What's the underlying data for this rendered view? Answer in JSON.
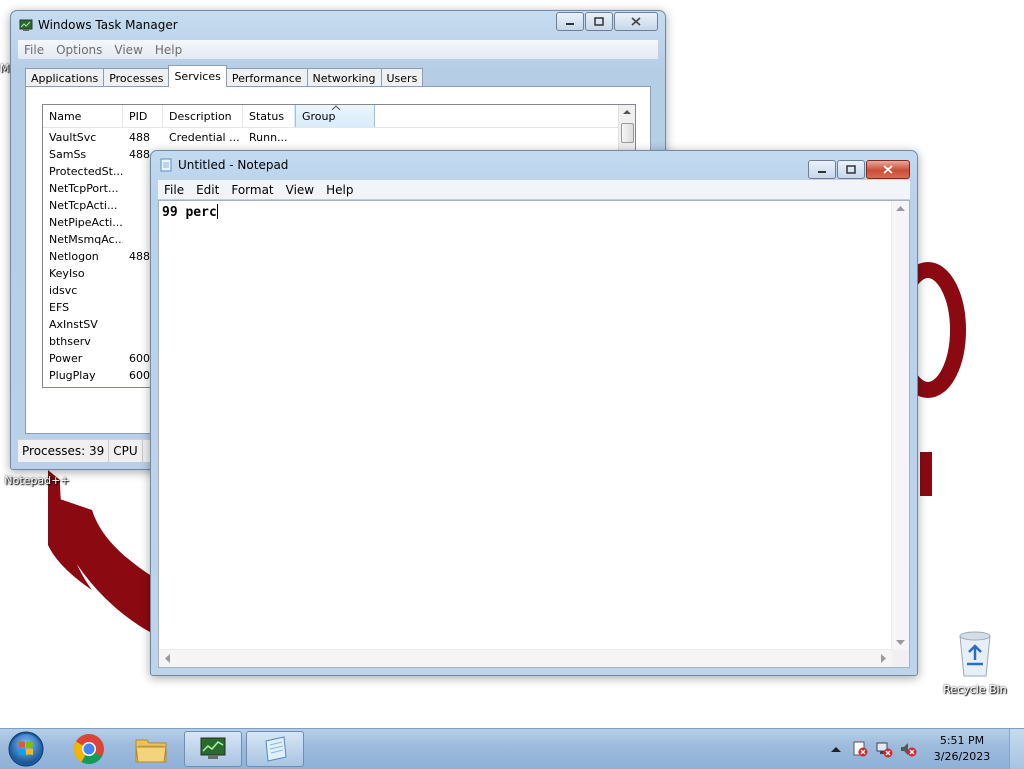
{
  "desktop": {
    "left_icon_partial": "M",
    "notepadpp_label": "Notepad++",
    "recycle_bin_label": "Recycle Bin",
    "wallpaper_color": "#8b0a12"
  },
  "task_manager": {
    "title": "Windows Task Manager",
    "menu": [
      "File",
      "Options",
      "View",
      "Help"
    ],
    "tabs": [
      "Applications",
      "Processes",
      "Services",
      "Performance",
      "Networking",
      "Users"
    ],
    "active_tab": "Services",
    "columns": [
      "Name",
      "PID",
      "Description",
      "Status",
      "Group"
    ],
    "rows": [
      {
        "name": "VaultSvc",
        "pid": "488",
        "description": "Credential ...",
        "status": "Runn..."
      },
      {
        "name": "SamSs",
        "pid": "488",
        "description": "",
        "status": ""
      },
      {
        "name": "ProtectedSt...",
        "pid": "",
        "description": "",
        "status": ""
      },
      {
        "name": "NetTcpPort...",
        "pid": "",
        "description": "",
        "status": ""
      },
      {
        "name": "NetTcpActi...",
        "pid": "",
        "description": "",
        "status": ""
      },
      {
        "name": "NetPipeActi...",
        "pid": "",
        "description": "",
        "status": ""
      },
      {
        "name": "NetMsmqAc...",
        "pid": "",
        "description": "",
        "status": ""
      },
      {
        "name": "Netlogon",
        "pid": "488",
        "description": "",
        "status": ""
      },
      {
        "name": "KeyIso",
        "pid": "",
        "description": "",
        "status": ""
      },
      {
        "name": "idsvc",
        "pid": "",
        "description": "",
        "status": ""
      },
      {
        "name": "EFS",
        "pid": "",
        "description": "",
        "status": ""
      },
      {
        "name": "AxInstSV",
        "pid": "",
        "description": "",
        "status": ""
      },
      {
        "name": "bthserv",
        "pid": "",
        "description": "",
        "status": ""
      },
      {
        "name": "Power",
        "pid": "600",
        "description": "",
        "status": ""
      },
      {
        "name": "PlugPlay",
        "pid": "600",
        "description": "",
        "status": ""
      }
    ],
    "status_processes": "Processes: 39",
    "status_cpu": "CPU"
  },
  "notepad": {
    "title": "Untitled - Notepad",
    "menu": [
      "File",
      "Edit",
      "Format",
      "View",
      "Help"
    ],
    "text": "99 perc"
  },
  "taskbar": {
    "time": "5:51 PM",
    "date": "3/26/2023",
    "items": [
      "start-button",
      "chrome",
      "windows-explorer",
      "task-manager",
      "notepad"
    ]
  }
}
